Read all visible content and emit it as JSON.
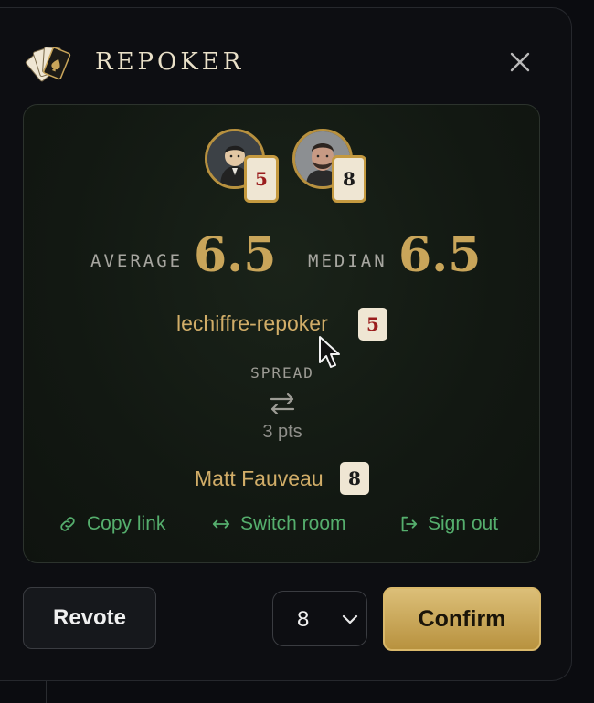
{
  "app": {
    "brand": "REPOKER"
  },
  "participants": [
    {
      "name": "lechiffre-repoker",
      "vote": "5"
    },
    {
      "name": "Matt Fauveau",
      "vote": "8"
    }
  ],
  "stats": {
    "average_label": "AVERAGE",
    "average_value": "6.5",
    "median_label": "MEDIAN",
    "median_value": "6.5",
    "spread_label": "SPREAD",
    "spread_value": "3 pts"
  },
  "links": {
    "copy_link": "Copy link",
    "switch_room": "Switch room",
    "sign_out": "Sign out"
  },
  "actions": {
    "revote": "Revote",
    "selected_vote": "8",
    "confirm": "Confirm"
  },
  "icons": [
    "card-fan-logo",
    "close-icon",
    "swap-arrows-icon",
    "link-icon",
    "switch-icon",
    "sign-out-icon",
    "chevron-down-icon",
    "mouse-cursor-icon"
  ],
  "colors": {
    "accent_gold": "#c9a55a",
    "link_green": "#55ae6d",
    "card_red": "#9a1d1d",
    "felt": "#121812"
  }
}
